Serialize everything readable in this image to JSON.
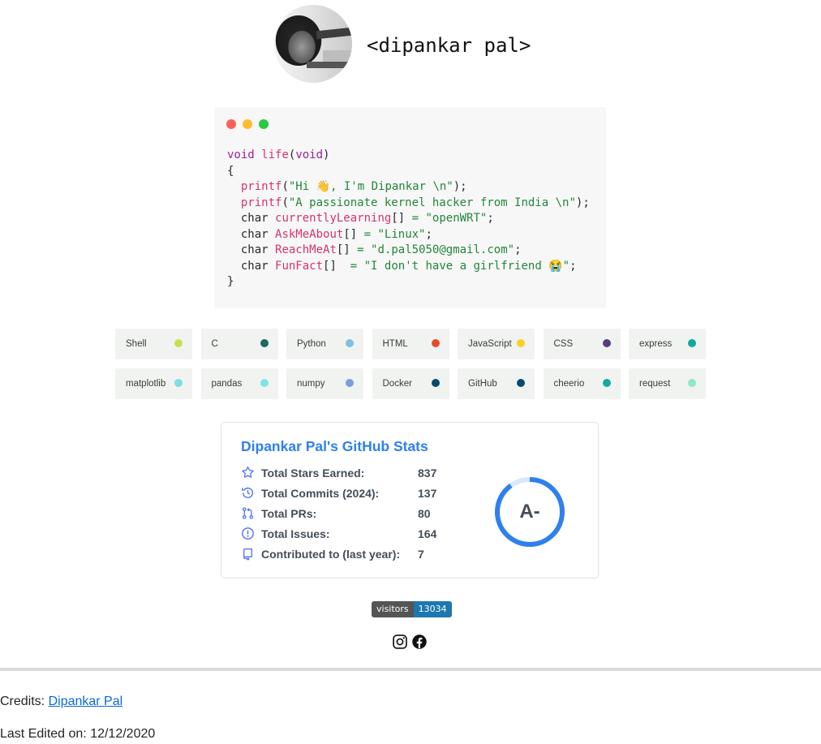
{
  "header": {
    "name": "<dipankar pal>"
  },
  "code": {
    "lines": [
      "void life(void)",
      "{",
      "  printf(\"Hi 👋, I'm Dipankar \\n\");",
      "  printf(\"A passionate kernel hacker from India \\n\");",
      "  char currentlyLearning[] = \"openWRT\";",
      "  char AskMeAbout[] = \"Linux\";",
      "  char ReachMeAt[] = \"d.pal5050@gmail.com\";",
      "  char FunFact[]  = \"I don't have a girlfriend 😭\";",
      "}"
    ],
    "dot_colors": [
      "#ff5f56",
      "#ffbd2e",
      "#27c93f"
    ]
  },
  "tech": [
    {
      "label": "Shell",
      "color": "#c6e24b"
    },
    {
      "label": "C",
      "color": "#1b6a5e"
    },
    {
      "label": "Python",
      "color": "#7fbfe2"
    },
    {
      "label": "HTML",
      "color": "#e44d26"
    },
    {
      "label": "JavaScript",
      "color": "#f7d21f"
    },
    {
      "label": "CSS",
      "color": "#563d7c"
    },
    {
      "label": "express",
      "color": "#11a89c"
    },
    {
      "label": "matplotlib",
      "color": "#7fdde6"
    },
    {
      "label": "pandas",
      "color": "#7ee5e5"
    },
    {
      "label": "numpy",
      "color": "#7b9de0"
    },
    {
      "label": "Docker",
      "color": "#0b4a6f"
    },
    {
      "label": "GitHub",
      "color": "#0b4a6f"
    },
    {
      "label": "cheerio",
      "color": "#11aaa5"
    },
    {
      "label": "request",
      "color": "#8fe8c8"
    }
  ],
  "stats": {
    "title": "Dipankar Pal's GitHub Stats",
    "rows": [
      {
        "label": "Total Stars Earned:",
        "value": "837",
        "icon": "star-icon"
      },
      {
        "label": "Total Commits (2024):",
        "value": "137",
        "icon": "history-icon"
      },
      {
        "label": "Total PRs:",
        "value": "80",
        "icon": "pull-request-icon"
      },
      {
        "label": "Total Issues:",
        "value": "164",
        "icon": "issue-icon"
      },
      {
        "label": "Contributed to (last year):",
        "value": "7",
        "icon": "repo-icon"
      }
    ],
    "grade": "A-",
    "ring_fraction": 0.9,
    "accent": "#2f80ed"
  },
  "badge": {
    "label": "visitors",
    "count": "13034"
  },
  "social": [
    "instagram-icon",
    "facebook-icon"
  ],
  "footer": {
    "credits_prefix": "Credits:",
    "credits_link": "Dipankar Pal",
    "last_edited": "Last Edited on: 12/12/2020"
  }
}
